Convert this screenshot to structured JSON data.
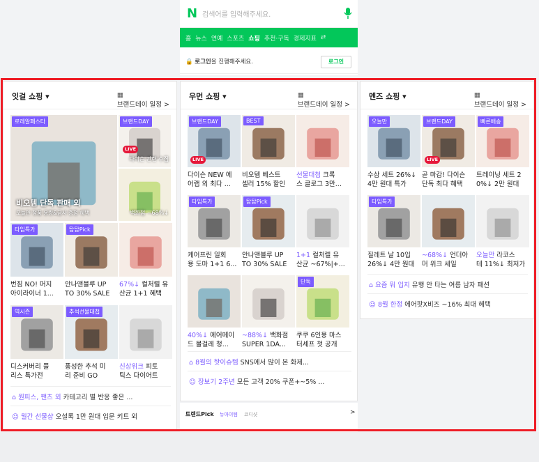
{
  "search": {
    "placeholder": "검색어를 입력해주세요.",
    "logo": "N"
  },
  "nav": {
    "items": [
      "홈",
      "뉴스",
      "연예",
      "스포츠",
      "쇼핑",
      "추천·구독",
      "경제지표"
    ],
    "active": 4,
    "more": "⇄"
  },
  "login": {
    "text_bold": "로그인",
    "text_rest": "을 진행해주세요.",
    "button": "로그인"
  },
  "colors": {
    "naver_green": "#03c75a",
    "badge_purple": "#7c5cff",
    "highlight_red": "#ee1c25",
    "live_red": "#e6183a"
  },
  "panels": [
    {
      "title": "잇걸 쇼핑 ▾",
      "link": "브랜드데이 일정 >",
      "hero": {
        "badge": "로레알페스타",
        "title": "비오템 단독 판매 외",
        "sub": "오늘만 정품 용량&금사 증정 혜택"
      },
      "side": [
        {
          "badge": "브랜드DAY",
          "text": "다이슨 관련 수집",
          "live": "LIVE"
        },
        {
          "text": "백화점 ~68%↓"
        }
      ],
      "grid": [
        {
          "badge": "타임특가",
          "caption": [
            "번짐 NO! 머지",
            "아이라이너 1..."
          ]
        },
        {
          "badge": "탑탑Pick",
          "caption": [
            "안나앤블루 UP",
            "TO 30% SALE"
          ]
        },
        {
          "caption": [
            "67%↓ 컬처렐 유",
            "산균 1+1 혜택"
          ],
          "hl": "67%↓"
        },
        {
          "badge": "역시즌",
          "caption": [
            "디스커버리 플",
            "리스 특가전"
          ]
        },
        {
          "badge": "추석선물대첩",
          "caption": [
            "풍성한 추석 미",
            "리 준비 GO"
          ]
        },
        {
          "caption": [
            "신상위크 피토",
            "틱스 다이어트"
          ],
          "hl": "신상위크"
        }
      ],
      "links": [
        {
          "hl": "원피스, 팬츠 외",
          "rest": " 카테고리 별 반응 좋은 ..."
        },
        {
          "hl": "월간 선물샵",
          "rest": " 오설록 1만 원대 입문 키트 외"
        }
      ]
    },
    {
      "title": "우먼 쇼핑 ▾",
      "link": "브랜드데이 일정 >",
      "grid": [
        {
          "badge": "브랜드DAY",
          "caption": [
            "다이슨 NEW 에",
            "어랩 외 최다 ..."
          ],
          "live": "LIVE"
        },
        {
          "badge": "BEST",
          "caption": [
            "비오템 베스트",
            "셀러 15% 할인"
          ]
        },
        {
          "caption": [
            "선물대첩 크록",
            "스 클로그 3만..."
          ],
          "hl": "선물대첩"
        },
        {
          "badge": "타임특가",
          "caption": [
            "케어프린 일회",
            "용 도마 1+1 6..."
          ]
        },
        {
          "badge": "탑탑Pick",
          "caption": [
            "안나앤블루 UP",
            "TO 30% SALE"
          ]
        },
        {
          "caption": [
            "1+1 컬처렐 유",
            "산균 ~67%|+..."
          ],
          "hl": "1+1"
        },
        {
          "caption": [
            "40%↓ 에어메이",
            "드 물걸레 청..."
          ],
          "hl": "40%↓"
        },
        {
          "caption": [
            "~88%↓ 백화점",
            "SUPER 1DA..."
          ],
          "hl": "~88%↓"
        },
        {
          "badge": "단독",
          "caption": [
            "쿠쿠 6인용 마스",
            "터셰프 첫 공개"
          ]
        }
      ],
      "links": [
        {
          "hl": "8월의 핫이슈템",
          "rest": " SNS에서 많이 본 화제..."
        },
        {
          "hl": "장보기 2주년",
          "rest": " 모든 고객 20% 쿠폰+~5% ..."
        }
      ]
    },
    {
      "title": "멘즈 쇼핑 ▾",
      "link": "브랜드데이 일정 >",
      "grid": [
        {
          "badge": "오늘만",
          "caption": [
            "수삼 세트 26%↓",
            "4만 원대 특가"
          ]
        },
        {
          "badge": "브랜드DAY",
          "caption": [
            "곧 마감! 다이슨",
            "단독 최다 혜택"
          ],
          "live": "LIVE"
        },
        {
          "badge": "빠른배송",
          "caption": [
            "트레이닝 세트 2",
            "0%↓ 2만 원대"
          ]
        },
        {
          "badge": "타임특가",
          "caption": [
            "질레트 날 10입",
            "26%↓ 4만 원대"
          ]
        },
        {
          "caption": [
            "~68%↓ 언더아",
            "머 위크 세일"
          ],
          "hl": "~68%↓"
        },
        {
          "caption": [
            "오늘만 라코스",
            "테 11%↓ 최저가"
          ],
          "hl": "오늘만"
        }
      ],
      "links": [
        {
          "hl": "요즘 뭐 입지",
          "rest": " 유행 안 타는 여름 남자 패션"
        },
        {
          "hl": "8월 한정",
          "rest": " 에어팟X비즈 ~16% 최대 혜택"
        }
      ]
    }
  ],
  "trend": {
    "title": "트렌드Pick",
    "tab1": "뉴아이템",
    "tab2": "코디샷",
    "arrow": ">"
  }
}
